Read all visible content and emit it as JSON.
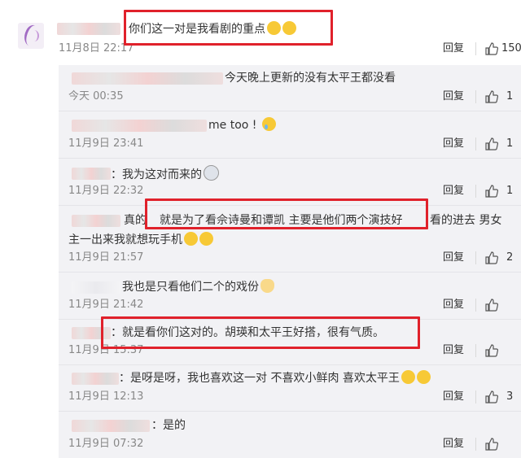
{
  "main_comment": {
    "text": "你们这一对是我看剧的重点",
    "time": "11月8日 22:17",
    "reply_label": "回复",
    "likes": "150"
  },
  "replies": [
    {
      "text": "今天晚上更新的没有太平王都没看",
      "time": "今天 00:35",
      "reply_label": "回复",
      "likes": "1"
    },
    {
      "text": "me too !",
      "time": "11月9日 23:41",
      "reply_label": "回复",
      "likes": "1"
    },
    {
      "text": "：我为这对而来的",
      "time": "11月9日 22:32",
      "reply_label": "回复",
      "likes": "1"
    },
    {
      "text_a": "真的",
      "text_b": "就是为了看佘诗曼和谭凯  主要是他们两个演技好",
      "text_c": "看的进去  男女",
      "text_line2": "主一出来我就想玩手机",
      "time": "11月9日 21:57",
      "reply_label": "回复",
      "likes": "2"
    },
    {
      "text": "我也是只看他们二个的戏份",
      "time": "11月9日 21:42",
      "reply_label": "回复",
      "likes": ""
    },
    {
      "text": "：就是看你们这对的。胡瑛和太平王好搭，很有气质。",
      "time": "11月9日 15:37",
      "reply_label": "回复",
      "likes": ""
    },
    {
      "text": "：是呀是呀，我也喜欢这一对 不喜欢小鲜肉 喜欢太平王",
      "time": "11月9日 12:13",
      "reply_label": "回复",
      "likes": "3"
    },
    {
      "text": "：是的",
      "time": "11月9日 07:32",
      "reply_label": "回复",
      "likes": ""
    }
  ],
  "colors": {
    "highlight_box": "#e0212b",
    "reply_bg": "#f2f2f5"
  }
}
